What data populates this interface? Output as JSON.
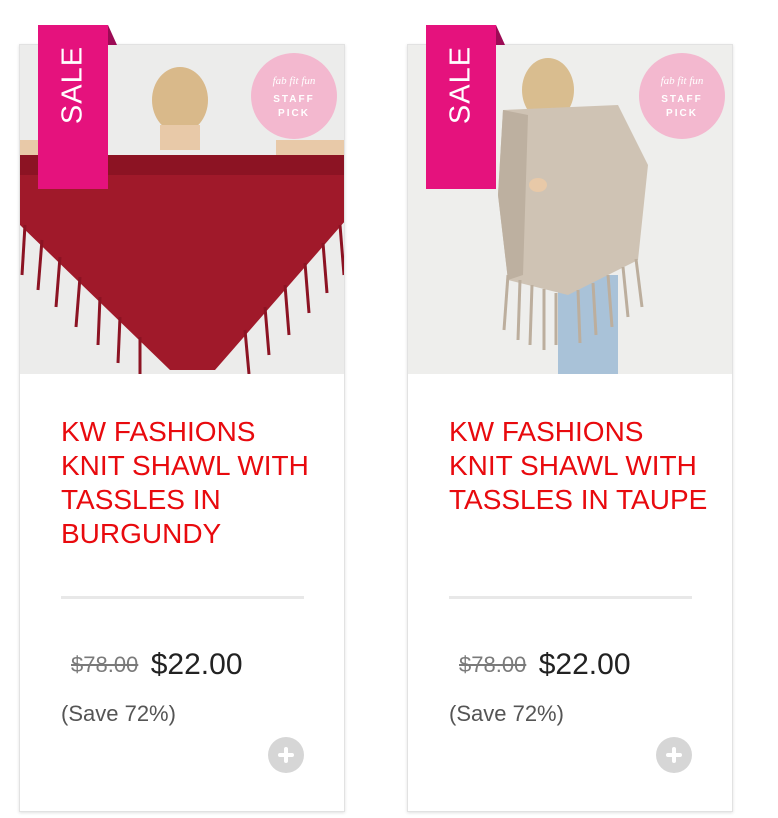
{
  "products": [
    {
      "sale_label": "SALE",
      "badge": {
        "brand": "fab fit fun",
        "line1": "STAFF",
        "line2": "PICK"
      },
      "title": "KW FASHIONS KNIT SHAWL WITH TASSLES IN BURGUNDY",
      "original_price": "$78.00",
      "sale_price": "$22.00",
      "savings": "(Save 72%)",
      "shawl_color": "#a0192a"
    },
    {
      "sale_label": "SALE",
      "badge": {
        "brand": "fab fit fun",
        "line1": "STAFF",
        "line2": "PICK"
      },
      "title": "KW FASHIONS KNIT SHAWL WITH TASSLES IN TAUPE",
      "original_price": "$78.00",
      "sale_price": "$22.00",
      "savings": "(Save 72%)",
      "shawl_color": "#cfc3b4"
    }
  ],
  "colors": {
    "sale_tag": "#e5127d",
    "title": "#e80a0e",
    "badge": "#f3b8cf"
  }
}
